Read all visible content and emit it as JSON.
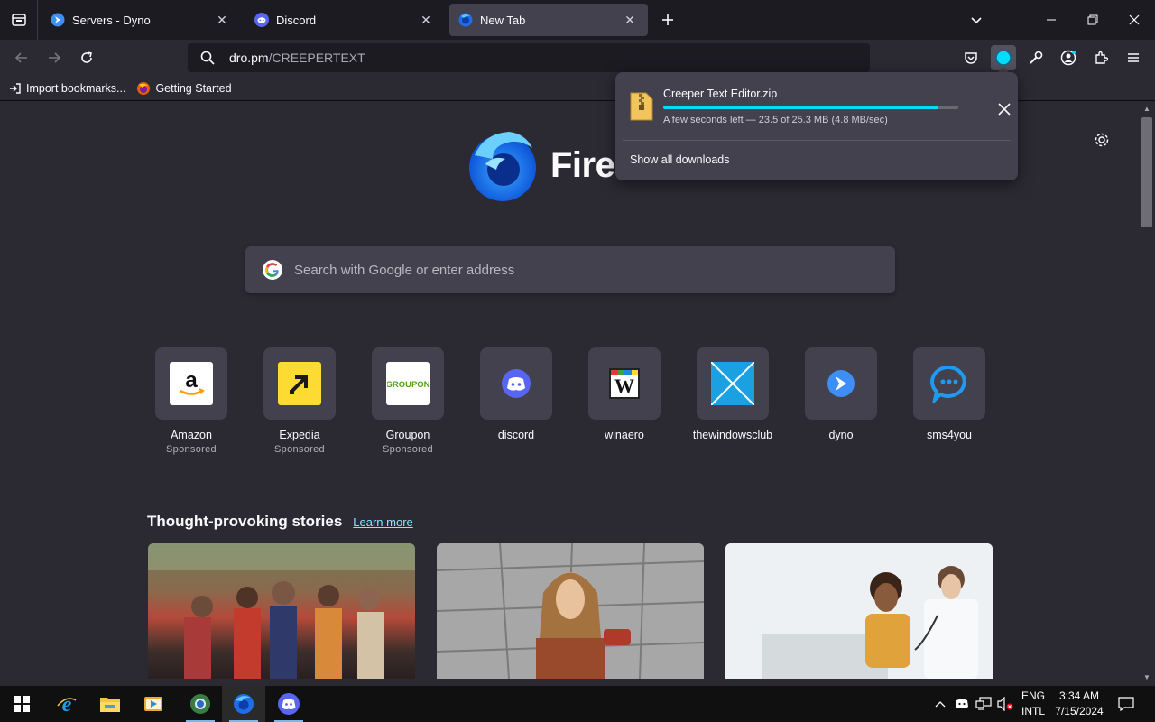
{
  "tabs": [
    {
      "title": "Servers - Dyno",
      "active": false
    },
    {
      "title": "Discord",
      "active": false
    },
    {
      "title": "New Tab",
      "active": true
    }
  ],
  "urlbar": {
    "host": "dro.pm",
    "path": "/CREEPERTEXT"
  },
  "bookmarks": [
    {
      "label": "Import bookmarks..."
    },
    {
      "label": "Getting Started"
    }
  ],
  "newtab": {
    "logo_text": "Fire",
    "search_placeholder": "Search with Google or enter address",
    "top_sites": [
      {
        "label": "Amazon",
        "sponsored": "Sponsored"
      },
      {
        "label": "Expedia",
        "sponsored": "Sponsored"
      },
      {
        "label": "Groupon",
        "sponsored": "Sponsored"
      },
      {
        "label": "discord",
        "sponsored": ""
      },
      {
        "label": "winaero",
        "sponsored": ""
      },
      {
        "label": "thewindowsclub",
        "sponsored": ""
      },
      {
        "label": "dyno",
        "sponsored": ""
      },
      {
        "label": "sms4you",
        "sponsored": ""
      }
    ],
    "stories_title": "Thought-provoking stories",
    "learn_more": "Learn more"
  },
  "downloads": {
    "filename": "Creeper Text Editor.zip",
    "status": "A few seconds left — 23.5 of 25.3 MB (4.8 MB/sec)",
    "progress_fraction": 0.93,
    "show_all": "Show all downloads"
  },
  "taskbar": {
    "lang_top": "ENG",
    "lang_bottom": "INTL",
    "time": "3:34 AM",
    "date": "7/15/2024"
  },
  "colors": {
    "accent": "#00ddff",
    "link": "#80ebff",
    "page_bg": "#2b2a33",
    "panel_bg": "#42414d"
  }
}
